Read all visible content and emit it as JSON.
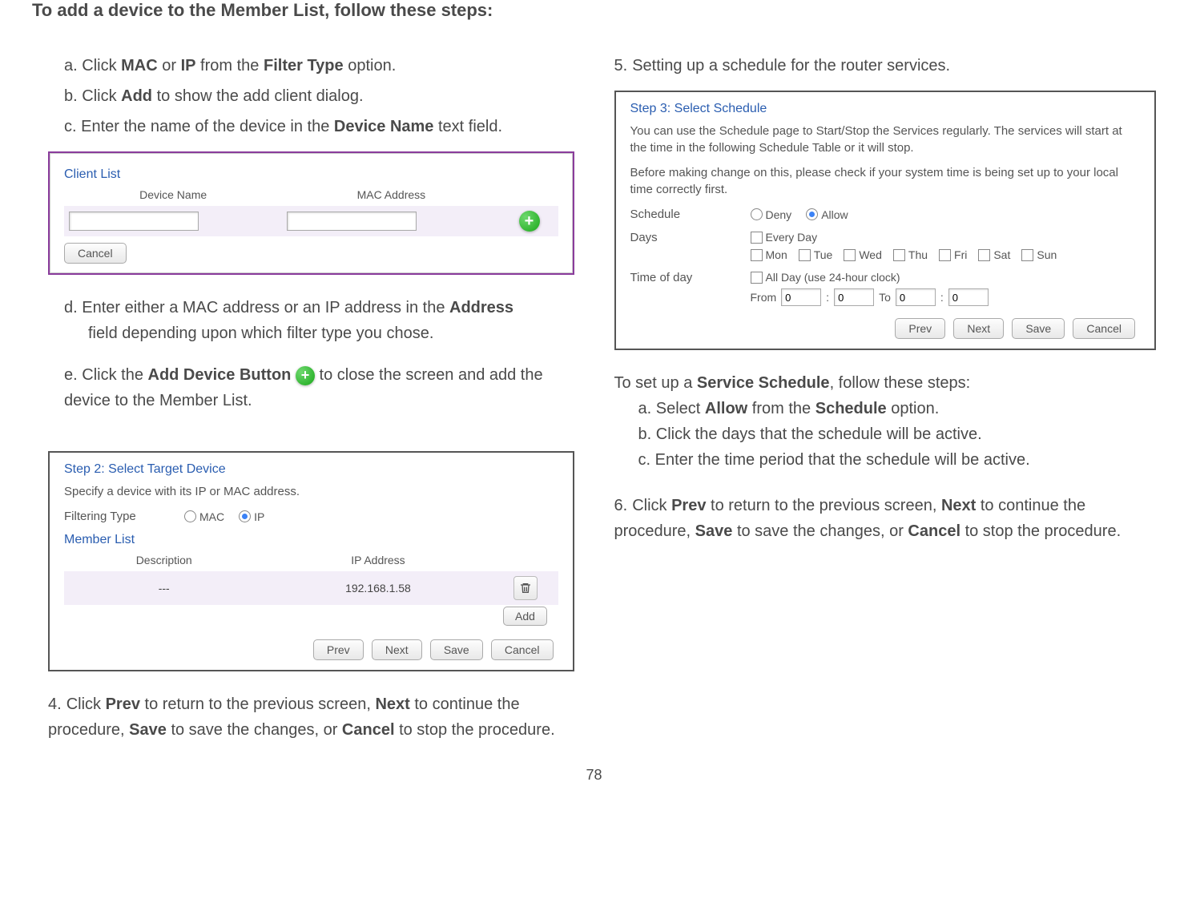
{
  "heading": "To add a device to the Member List, follow these steps:",
  "left": {
    "steps_a": [
      "Click ",
      "MAC",
      " or ",
      "IP",
      " from the ",
      "Filter Type",
      " option."
    ],
    "steps_b": [
      "Click ",
      "Add",
      " to show the add client dialog."
    ],
    "steps_c": [
      "Enter the name of the device in the ",
      "Device Name",
      " text field."
    ],
    "steps_d": [
      "Enter either a MAC address or an IP address in the ",
      "Address",
      " field depending upon which filter type you chose."
    ],
    "steps_e": [
      "Click the ",
      "Add Device Button",
      "  to close the screen and add the device to the Member List."
    ],
    "step4": [
      "Click ",
      "Prev",
      " to return to the previous screen, ",
      "Next",
      " to continue the procedure, ",
      "Save",
      " to save the changes, or ",
      "Cancel",
      " to stop the procedure."
    ]
  },
  "right": {
    "step5": "Setting up a schedule for the router services.",
    "setup_intro": [
      "To set up a ",
      "Service Schedule",
      ", follow these steps:"
    ],
    "setup_a": [
      "Select ",
      "Allow",
      " from the ",
      "Schedule",
      " option."
    ],
    "setup_b": "Click the days that the schedule will be active.",
    "setup_c": "Enter the time period that the schedule will be active.",
    "step6": [
      "Click ",
      "Prev",
      " to return to the previous screen, ",
      "Next",
      " to continue the procedure, ",
      "Save",
      " to save the changes, or ",
      "Cancel",
      " to stop the procedure."
    ]
  },
  "client_list_shot": {
    "title": "Client List",
    "col1": "Device Name",
    "col2": "MAC Address",
    "cancel": "Cancel"
  },
  "target_device_shot": {
    "step": "Step 2: Select Target Device",
    "desc": "Specify a device with its IP or MAC address.",
    "filter_label": "Filtering Type",
    "mac": "MAC",
    "ip": "IP",
    "member_list": "Member List",
    "col1": "Description",
    "col2": "IP Address",
    "row_desc": "---",
    "row_ip": "192.168.1.58",
    "add": "Add",
    "prev": "Prev",
    "next": "Next",
    "save": "Save",
    "cancel": "Cancel"
  },
  "schedule_shot": {
    "step": "Step 3: Select Schedule",
    "desc1": "You can use the Schedule page to Start/Stop the Services regularly. The services will start at the time in the following Schedule Table or it will stop.",
    "desc2": "Before making change on this, please check if your system time is being set up to your local time correctly first.",
    "schedule_label": "Schedule",
    "deny": "Deny",
    "allow": "Allow",
    "days_label": "Days",
    "every_day": "Every Day",
    "days": [
      "Mon",
      "Tue",
      "Wed",
      "Thu",
      "Fri",
      "Sat",
      "Sun"
    ],
    "tod_label": "Time of day",
    "all_day": "All Day (use 24-hour clock)",
    "from": "From",
    "to": "To",
    "v1": "0",
    "v2": "0",
    "v3": "0",
    "v4": "0",
    "prev": "Prev",
    "next": "Next",
    "save": "Save",
    "cancel": "Cancel"
  },
  "page_number": "78"
}
